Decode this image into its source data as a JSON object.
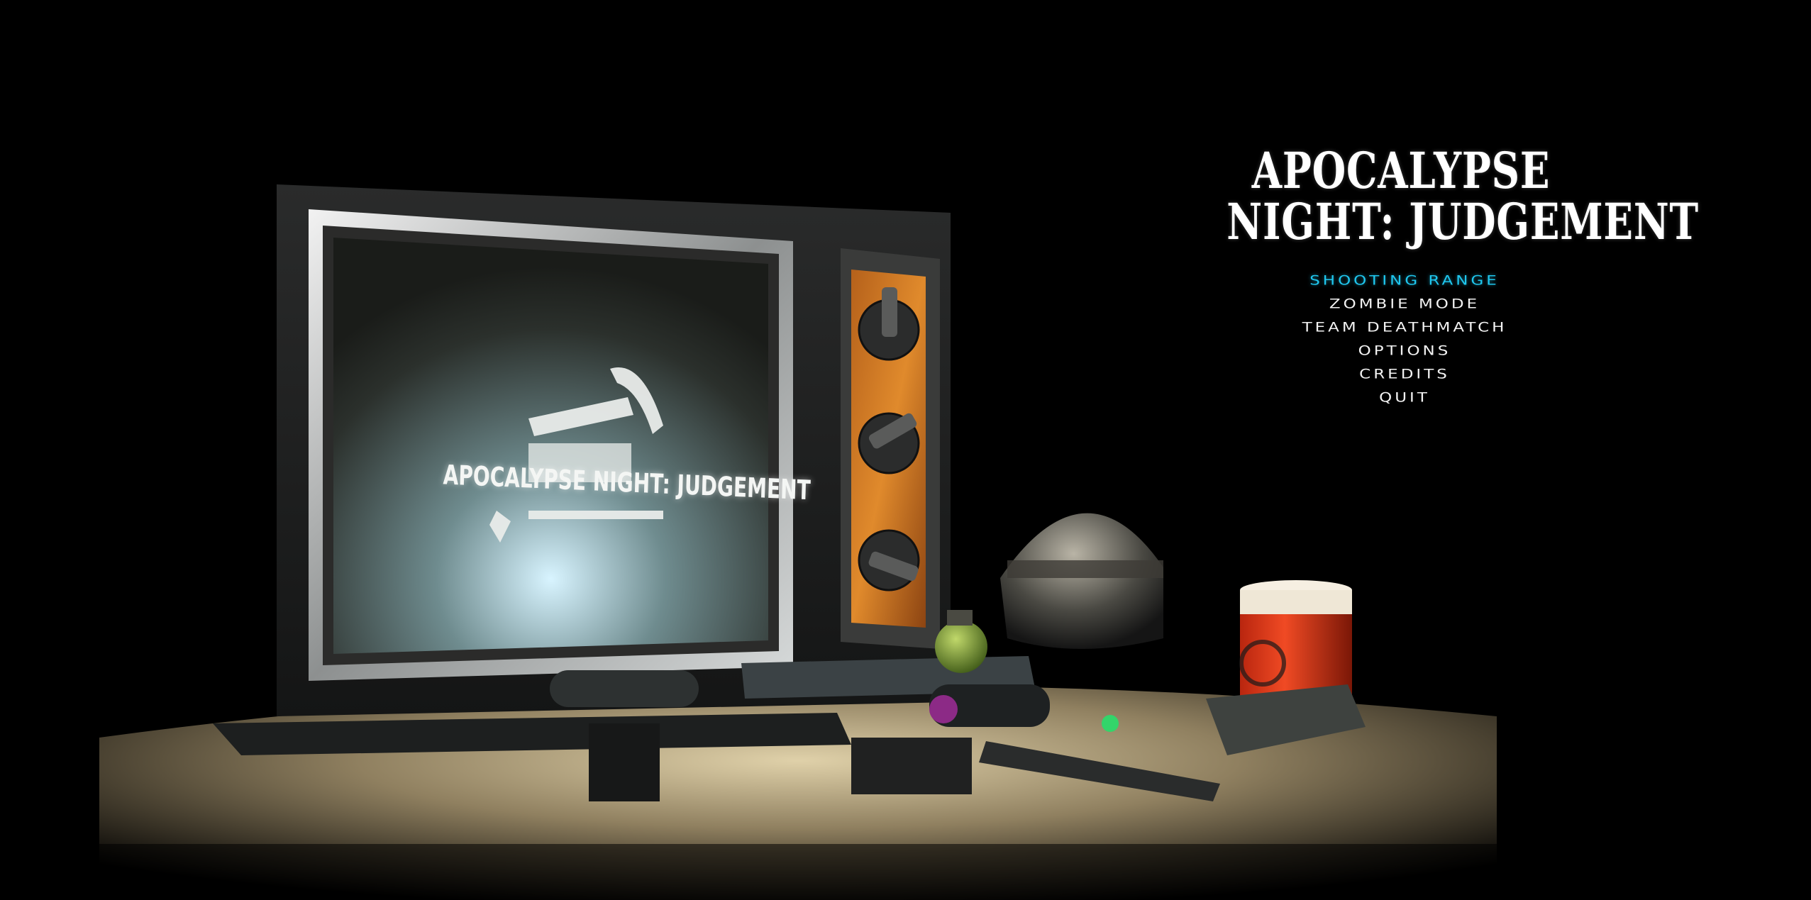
{
  "title": {
    "line1": "APOCALYPSE",
    "line2": "NIGHT: JUDGEMENT"
  },
  "screen_logo_text": "APOCALYPSE NIGHT: JUDGEMENT",
  "menu": {
    "items": [
      {
        "label": "SHOOTING RANGE",
        "selected": true
      },
      {
        "label": "ZOMBIE MODE",
        "selected": false
      },
      {
        "label": "TEAM DEATHMATCH",
        "selected": false
      },
      {
        "label": "OPTIONS",
        "selected": false
      },
      {
        "label": "CREDITS",
        "selected": false
      },
      {
        "label": "QUIT",
        "selected": false
      }
    ]
  },
  "colors": {
    "background": "#000000",
    "menu_text": "#f2f2f2",
    "menu_selected": "#1fc7ef",
    "title_text": "#ffffff",
    "can_orange": "#e0341a"
  }
}
